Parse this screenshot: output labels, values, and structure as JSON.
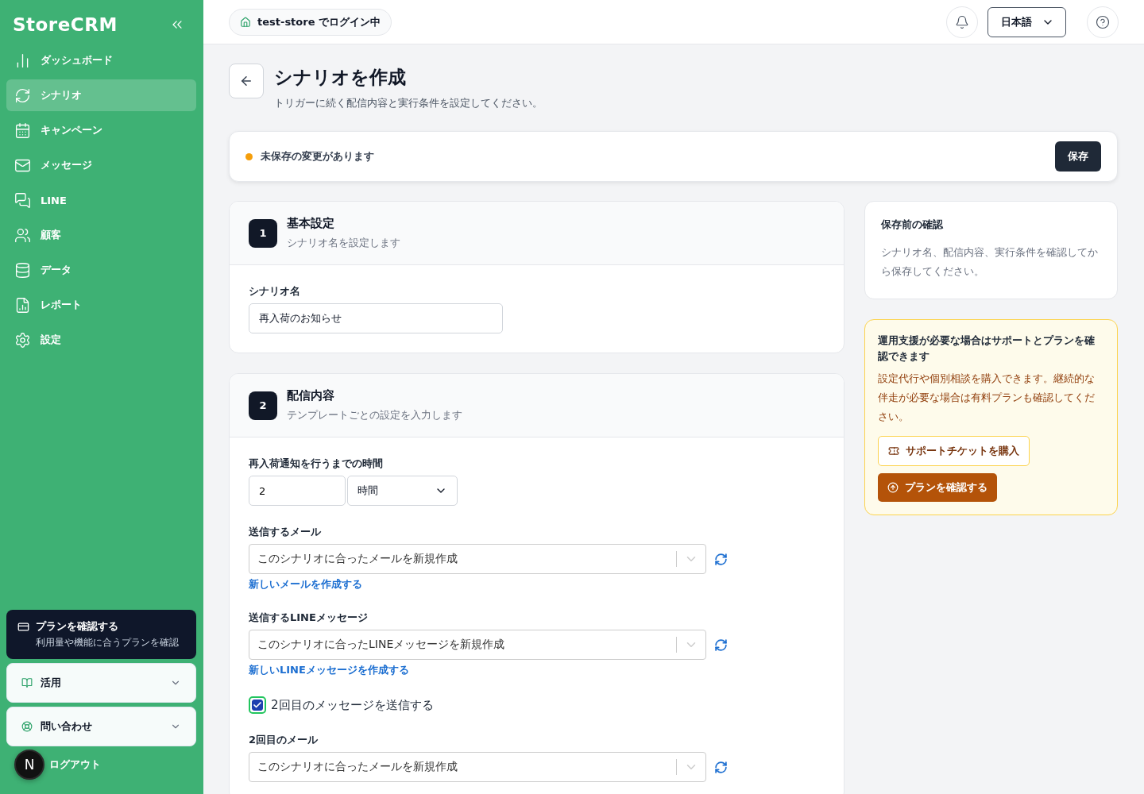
{
  "sidebar": {
    "logo": "StoreCRM",
    "nav": [
      {
        "label": "ダッシュボード",
        "selected": false
      },
      {
        "label": "シナリオ",
        "selected": true
      },
      {
        "label": "キャンペーン",
        "selected": false
      },
      {
        "label": "メッセージ",
        "selected": false
      },
      {
        "label": "LINE",
        "selected": false
      },
      {
        "label": "顧客",
        "selected": false
      },
      {
        "label": "データ",
        "selected": false
      },
      {
        "label": "レポート",
        "selected": false
      },
      {
        "label": "設定",
        "selected": false
      }
    ],
    "plan_card": {
      "title": "プランを確認する",
      "subtitle": "利用量や機能に合うプランを確認"
    },
    "accordions": [
      {
        "label": "活用",
        "expanded": false
      },
      {
        "label": "問い合わせ",
        "expanded": false
      }
    ],
    "user": {
      "avatar": "N",
      "logout": "ログアウト"
    }
  },
  "header": {
    "store_badge": "test-store でログイン中",
    "language": "日本語"
  },
  "page": {
    "title": "シナリオを作成",
    "subtitle": "トリガーに続く配信内容と実行条件を設定してください。"
  },
  "unsaved_bar": {
    "message": "未保存の変更があります",
    "save_button": "保存"
  },
  "sections": [
    {
      "number": "1",
      "title": "基本設定",
      "subtitle": "シナリオ名を設定します",
      "fields": [
        {
          "kind": "text",
          "label": "シナリオ名",
          "value": "再入荷のお知らせ"
        }
      ]
    },
    {
      "number": "2",
      "title": "配信内容",
      "subtitle": "テンプレートごとの設定を入力します",
      "fields": [
        {
          "kind": "duration",
          "label": "再入荷通知を行うまでの時間",
          "value": "2",
          "unit": "時間"
        },
        {
          "kind": "select",
          "label": "送信するメール",
          "value": "このシナリオに合ったメールを新規作成",
          "link": "新しいメールを作成する"
        },
        {
          "kind": "select",
          "label": "送信するLINEメッセージ",
          "value": "このシナリオに合ったLINEメッセージを新規作成",
          "link": "新しいLINEメッセージを作成する"
        },
        {
          "kind": "checkbox",
          "label": "2回目のメッセージを送信する",
          "checked": true
        },
        {
          "kind": "select",
          "label": "2回目のメール",
          "value": "このシナリオに合ったメールを新規作成"
        }
      ]
    }
  ],
  "confirm_card": {
    "title": "保存前の確認",
    "text": "シナリオ名、配信内容、実行条件を確認してから保存してください。"
  },
  "support_card": {
    "title": "運用支援が必要な場合はサポートとプランを確認できます",
    "text": "設定代行や個別相談を購入できます。継続的な伴走が必要な場合は有料プランも確認してください。",
    "buttons": [
      {
        "kind": "outline",
        "label": "サポートチケットを購入"
      },
      {
        "kind": "primary",
        "label": "プランを確認する"
      }
    ]
  }
}
